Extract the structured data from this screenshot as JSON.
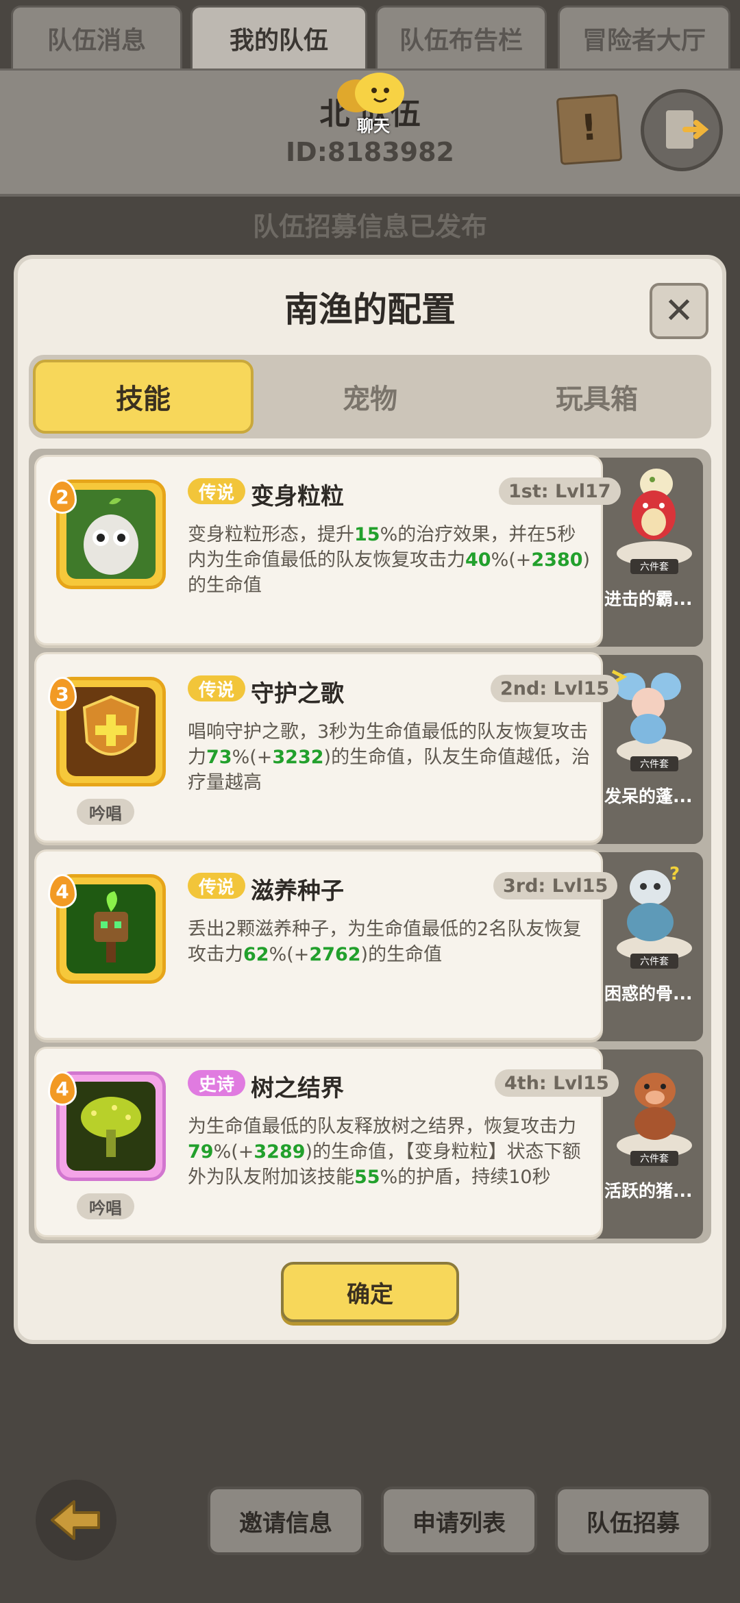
{
  "top_tabs": [
    {
      "label": "队伍消息"
    },
    {
      "label": "我的队伍"
    },
    {
      "label": "队伍布告栏"
    },
    {
      "label": "冒险者大厅"
    }
  ],
  "header": {
    "team_name": "北 队伍",
    "team_id": "ID:8183982",
    "chat_label": "聊天"
  },
  "status_text": "队伍招募信息已发布",
  "modal": {
    "title": "南渔的配置",
    "tabs": [
      {
        "label": "技能"
      },
      {
        "label": "宠物"
      },
      {
        "label": "玩具箱"
      }
    ],
    "skills": [
      {
        "badge": "2",
        "rarity": "传说",
        "name": "变身粒粒",
        "slot": "1st: Lvl17",
        "chant": "",
        "desc_parts": [
          "变身粒粒形态，提升",
          "15",
          "%的治疗效果，并在5秒内为生命值最低的队友恢复攻击力",
          "40",
          "%(+",
          "2380",
          ")的生命值"
        ]
      },
      {
        "badge": "3",
        "rarity": "传说",
        "name": "守护之歌",
        "slot": "2nd: Lvl15",
        "chant": "吟唱",
        "desc_parts": [
          "唱响守护之歌，3秒为生命值最低的队友恢复攻击力",
          "73",
          "%(+",
          "3232",
          ")的生命值，队友生命值越低，治疗量越高"
        ]
      },
      {
        "badge": "4",
        "rarity": "传说",
        "name": "滋养种子",
        "slot": "3rd: Lvl15",
        "chant": "",
        "desc_parts": [
          "丢出2颗滋养种子，为生命值最低的2名队友恢复攻击力",
          "62",
          "%(+",
          "2762",
          ")的生命值"
        ]
      },
      {
        "badge": "4",
        "rarity": "史诗",
        "name": "树之结界",
        "slot": "4th: Lvl15",
        "chant": "吟唱",
        "desc_parts": [
          "为生命值最低的队友释放树之结界，恢复攻击力",
          "79",
          "%(+",
          "3289",
          ")的生命值，【变身粒粒】状态下额外为队友附加该技能",
          "55",
          "%的护盾，持续10秒"
        ]
      }
    ],
    "pets": [
      {
        "name": "进击的霸...",
        "tag": "六件套"
      },
      {
        "name": "发呆的蓬...",
        "tag": "六件套"
      },
      {
        "name": "困惑的骨...",
        "tag": "六件套"
      },
      {
        "name": "活跃的猪...",
        "tag": "六件套"
      }
    ],
    "confirm_label": "确定"
  },
  "bottom_buttons": [
    {
      "label": "邀请信息"
    },
    {
      "label": "申请列表"
    },
    {
      "label": "队伍招募"
    }
  ],
  "colors": {
    "accent_yellow": "#f7d75a",
    "value_green": "#22a02c",
    "legend_rarity": "#f2c53a",
    "epic_rarity": "#e07be0",
    "level_badge": "#f29a24"
  }
}
